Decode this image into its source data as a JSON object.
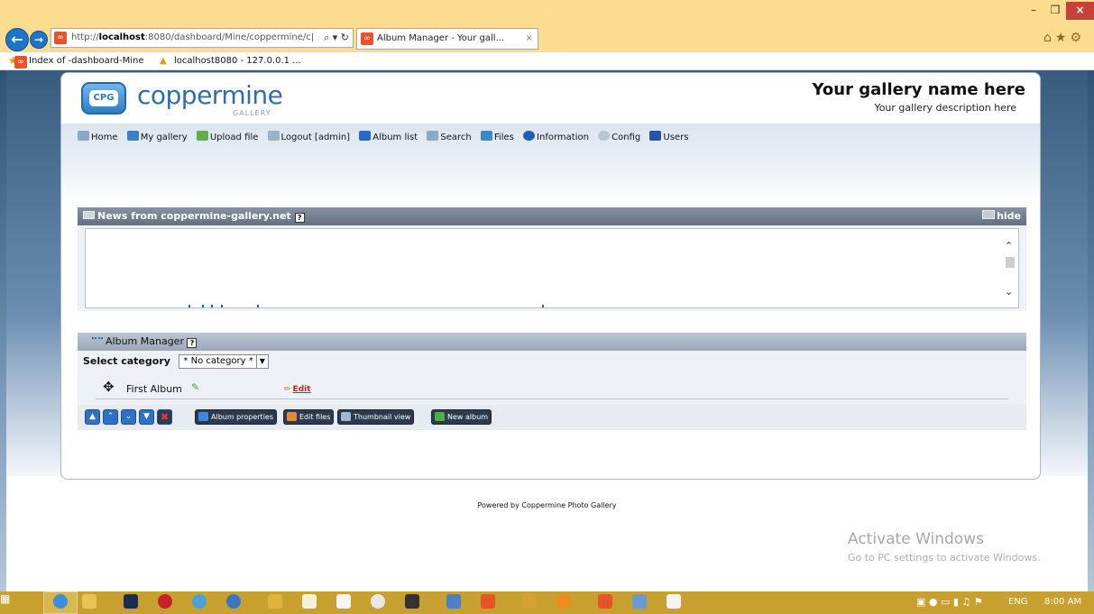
{
  "browser": {
    "address_prefix": "http://",
    "address_host": "localhost",
    "address_rest": ":8080/dashboard/Mine/coppermine/c|",
    "address_tools": "⌕ ▾ ↻",
    "tab_title": "Album Manager - Your gall...",
    "tab_close": "×",
    "favorites": [
      {
        "label": "Index of -dashboard-Mine"
      },
      {
        "label": "localhost8080 - 127.0.0.1 ..."
      }
    ]
  },
  "site": {
    "logo_badge": "CPG",
    "logo_text": "coppermine",
    "logo_sub": "GALLERY",
    "gallery_name": "Your gallery name here",
    "gallery_description": "Your gallery description here"
  },
  "menu": [
    {
      "label": "Home",
      "icon": "home-icon",
      "color": "#8aa9c8"
    },
    {
      "label": "My gallery",
      "icon": "gallery-icon",
      "color": "#3a7fc8"
    },
    {
      "label": "Upload file",
      "icon": "upload-icon",
      "color": "#5fb04a"
    },
    {
      "label": "Logout [admin]",
      "icon": "logout-icon",
      "color": "#9fb2c5"
    },
    {
      "label": "Album list",
      "icon": "album-list-icon",
      "color": "#2a6bc2"
    },
    {
      "label": "Search",
      "icon": "search-icon",
      "color": "#8aa9c8"
    },
    {
      "label": "Files",
      "icon": "files-icon",
      "color": "#3f86c9"
    },
    {
      "label": "Information",
      "icon": "info-icon",
      "color": "#1e5eb8"
    },
    {
      "label": "Config",
      "icon": "config-icon",
      "color": "#b8c4d0"
    },
    {
      "label": "Users",
      "icon": "users-icon",
      "color": "#2456a8"
    }
  ],
  "news": {
    "title": "News from coppermine-gallery.net",
    "help": "?",
    "hide_label": "hide"
  },
  "album_manager": {
    "title": "Album Manager",
    "help": "?",
    "select_label": "Select category",
    "selected_category": "* No category *",
    "albums": [
      {
        "name": "First Album",
        "edit_label": "Edit"
      }
    ],
    "buttons": {
      "album_properties": "Album properties",
      "edit_files": "Edit files",
      "thumbnail_view": "Thumbnail view",
      "new_album": "New album"
    }
  },
  "footer": {
    "powered_by": "Powered by Coppermine Photo Gallery"
  },
  "watermark": {
    "title": "Activate Windows",
    "subtitle": "Go to PC settings to activate Windows."
  },
  "taskbar": {
    "language": "ENG",
    "clock": "8:00 AM"
  }
}
